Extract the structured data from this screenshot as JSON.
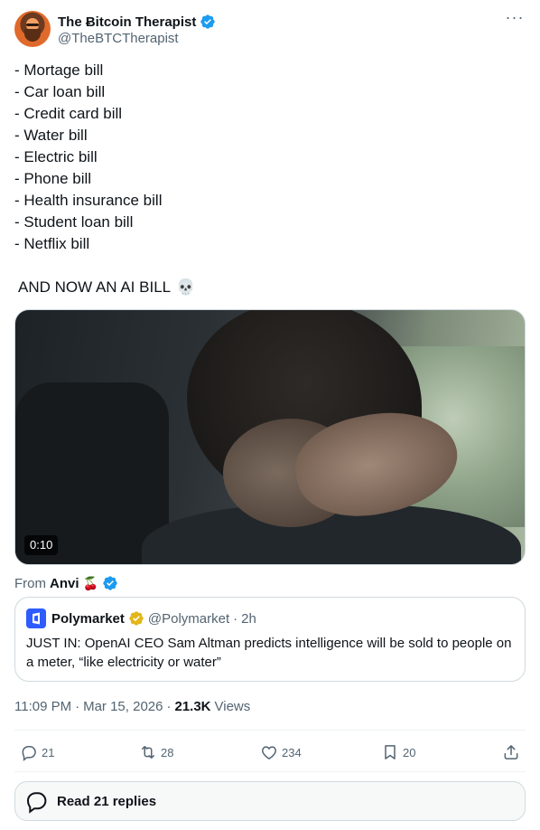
{
  "author": {
    "display_name": "The Ƀitcoin Therapist",
    "handle": "@TheBTCTherapist"
  },
  "more_label": "···",
  "tweet": {
    "bill_lines": [
      "- Mortage bill",
      "- Car loan bill",
      "- Credit card bill",
      "- Water bill",
      "- Electric bill",
      "- Phone bill",
      "- Health insurance bill",
      "- Student loan bill",
      "- Netflix bill"
    ],
    "closing_line": "AND NOW AN AI BILL",
    "closing_emoji": "💀"
  },
  "video": {
    "duration": "0:10"
  },
  "from": {
    "prefix": "From",
    "source": "Anvi",
    "emoji": "🍒"
  },
  "quote": {
    "name": "Polymarket",
    "handle": "@Polymarket",
    "separator": "·",
    "time": "2h",
    "text": "JUST IN: OpenAI CEO Sam Altman predicts intelligence will be sold to people on a meter, “like electricity or water”"
  },
  "meta": {
    "time": "11:09 PM",
    "dot1": "·",
    "date": "Mar 15, 2026",
    "dot2": "·",
    "views_count": "21.3K",
    "views_label": "Views"
  },
  "actions": {
    "replies": "21",
    "reposts": "28",
    "likes": "234",
    "bookmarks": "20"
  },
  "read_replies_label": "Read 21 replies",
  "colors": {
    "verified_blue": "#1d9bf0",
    "verified_gold": "#e2b719",
    "secondary_text": "#536471",
    "border": "#cfd9de",
    "polymarket_blue": "#2e5cff"
  }
}
